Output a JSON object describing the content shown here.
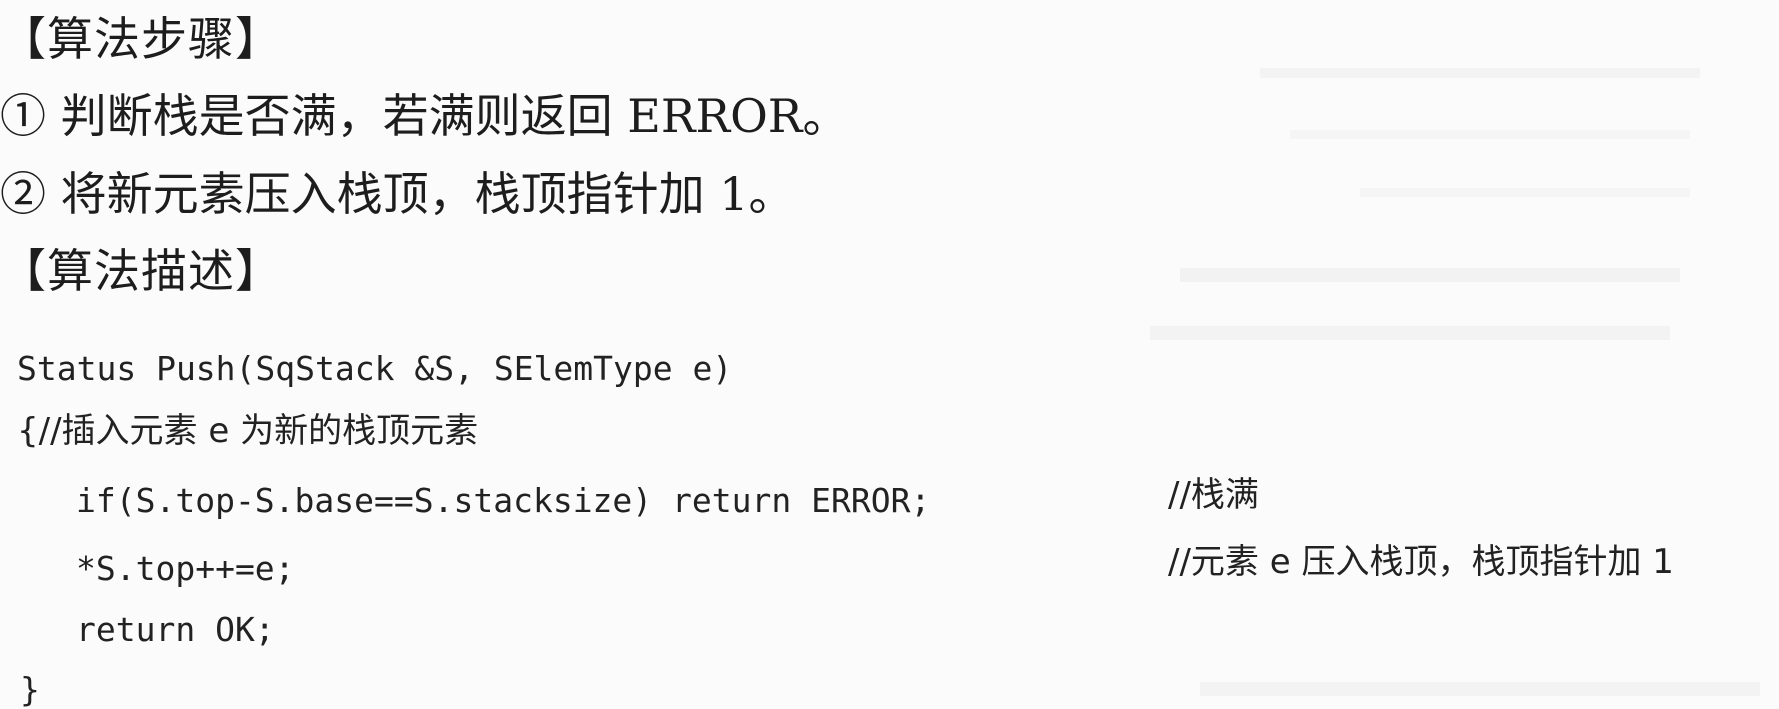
{
  "headings": {
    "steps_title": "【算法步骤】",
    "desc_title": "【算法描述】"
  },
  "steps": [
    "① 判断栈是否满，若满则返回 ERROR。",
    "② 将新元素压入栈顶，栈顶指针加 1。"
  ],
  "code": {
    "signature": "Status Push(SqStack &S, SElemType e)",
    "open_comment": "{//插入元素 e 为新的栈顶元素",
    "line_if": "if(S.top-S.base==S.stacksize) return ERROR;",
    "comment_if": "//栈满",
    "line_push": "*S.top++=e;",
    "comment_push": "//元素 e 压入栈顶，栈顶指针加 1",
    "line_return": "return OK;",
    "close_brace": "}"
  }
}
